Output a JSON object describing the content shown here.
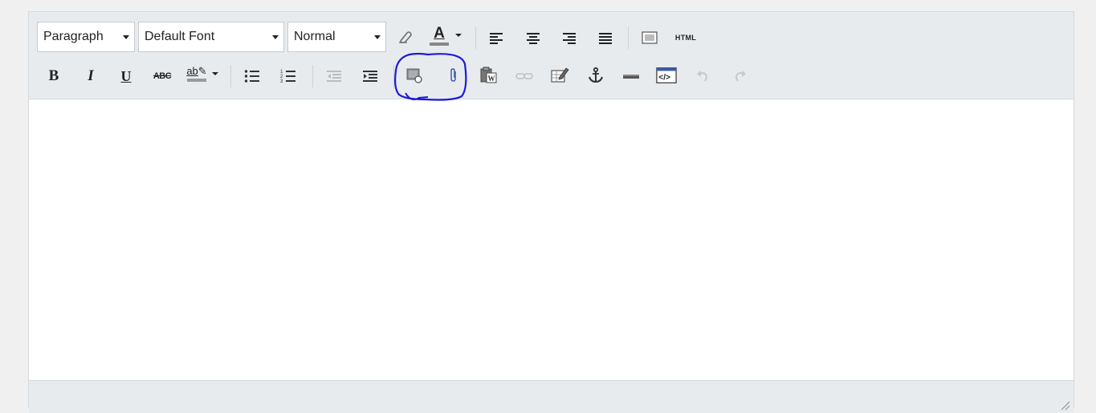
{
  "toolbar": {
    "paragraph_select": "Paragraph",
    "font_select": "Default Font",
    "size_select": "Normal",
    "html_label": "HTML",
    "bold_label": "B",
    "italic_label": "I",
    "underline_label": "U",
    "strike_label": "ABC",
    "highlight_label": "ab",
    "font_color_label": "A"
  },
  "icons": [
    "eraser-icon",
    "font-color-icon",
    "align-left-icon",
    "align-center-icon",
    "align-right-icon",
    "align-justify-icon",
    "fullscreen-icon",
    "bullet-list-icon",
    "numbered-list-icon",
    "outdent-icon",
    "indent-icon",
    "insert-image-icon",
    "attach-file-icon",
    "paste-word-icon",
    "link-icon",
    "edit-table-icon",
    "anchor-icon",
    "horizontal-rule-icon",
    "source-code-icon",
    "undo-icon",
    "redo-icon",
    "resize-handle-icon"
  ],
  "colors": {
    "toolbar_bg": "#e8ebee",
    "annotation_circle": "#1a1adb",
    "disabled_icon": "#b8b8b8"
  }
}
